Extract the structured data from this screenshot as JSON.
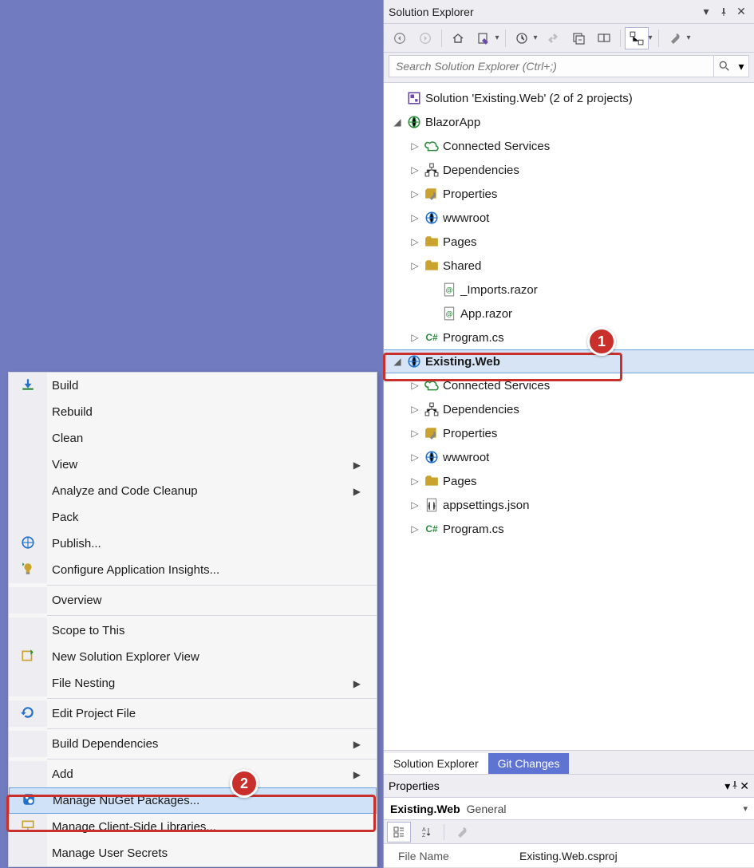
{
  "panel": {
    "title": "Solution Explorer",
    "search_placeholder": "Search Solution Explorer (Ctrl+;)"
  },
  "tree": {
    "solution": "Solution 'Existing.Web' (2 of 2 projects)",
    "project1": {
      "name": "BlazorApp",
      "children": {
        "conn": "Connected Services",
        "deps": "Dependencies",
        "props": "Properties",
        "www": "wwwroot",
        "pages": "Pages",
        "shared": "Shared",
        "imports": "_Imports.razor",
        "app": "App.razor",
        "program": "Program.cs"
      }
    },
    "project2": {
      "name": "Existing.Web",
      "children": {
        "conn": "Connected Services",
        "deps": "Dependencies",
        "props": "Properties",
        "www": "wwwroot",
        "pages": "Pages",
        "appsettings": "appsettings.json",
        "program": "Program.cs"
      }
    }
  },
  "context_menu": {
    "build": "Build",
    "rebuild": "Rebuild",
    "clean": "Clean",
    "view": "View",
    "analyze": "Analyze and Code Cleanup",
    "pack": "Pack",
    "publish": "Publish...",
    "insights": "Configure Application Insights...",
    "overview": "Overview",
    "scope": "Scope to This",
    "newview": "New Solution Explorer View",
    "filenest": "File Nesting",
    "editproj": "Edit Project File",
    "builddeps": "Build Dependencies",
    "add": "Add",
    "nuget": "Manage NuGet Packages...",
    "clientlibs": "Manage Client-Side Libraries...",
    "secrets": "Manage User Secrets"
  },
  "tabs": {
    "se": "Solution Explorer",
    "git": "Git Changes"
  },
  "properties": {
    "title": "Properties",
    "item_name": "Existing.Web",
    "item_type": "General",
    "grid": {
      "file_name_key": "File Name",
      "file_name_val": "Existing.Web.csproj"
    }
  },
  "callouts": {
    "one": "1",
    "two": "2"
  }
}
